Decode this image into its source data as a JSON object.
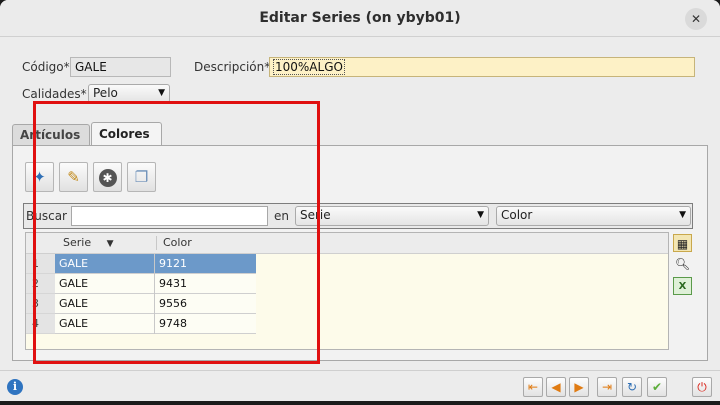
{
  "window": {
    "title": "Editar Series (on ybyb01)"
  },
  "form": {
    "codigo_label": "Código*",
    "codigo_value": "GALE",
    "descripcion_label": "Descripción*",
    "descripcion_value": "100%ALGO",
    "calidades_label": "Calidades*",
    "calidades_value": "Pelo"
  },
  "tabs": [
    {
      "label": "Artículos",
      "active": false
    },
    {
      "label": "Colores",
      "active": true
    }
  ],
  "toolbar": {
    "icons": [
      "new-record-icon",
      "edit-record-icon",
      "delete-record-icon",
      "copy-record-icon"
    ]
  },
  "search": {
    "label": "Buscar",
    "value": "",
    "in_label": "en",
    "field_value": "Serie",
    "column_value": "Color"
  },
  "grid": {
    "columns": [
      "Serie",
      "Color"
    ],
    "rows": [
      {
        "num": "1",
        "serie": "GALE",
        "color": "9121",
        "selected": true
      },
      {
        "num": "2",
        "serie": "GALE",
        "color": "9431",
        "selected": false
      },
      {
        "num": "3",
        "serie": "GALE",
        "color": "9556",
        "selected": false
      },
      {
        "num": "4",
        "serie": "GALE",
        "color": "9748",
        "selected": false
      }
    ]
  },
  "side_icons": [
    "table-settings-icon",
    "search-icon",
    "excel-export-icon"
  ],
  "nav_icons": [
    "first-icon",
    "previous-icon",
    "next-icon",
    "last-icon",
    "refresh-icon",
    "accept-icon",
    "exit-icon"
  ],
  "colors": {
    "accent": "#6c99c9",
    "highlight_box": "#e01010",
    "description_bg": "#fdf1c6"
  }
}
